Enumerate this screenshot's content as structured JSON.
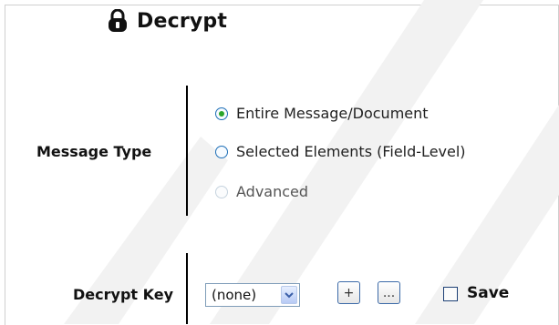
{
  "header": {
    "title": "Decrypt",
    "icon": "lock-icon"
  },
  "message_type": {
    "label": "Message Type",
    "options": [
      {
        "label": "Entire Message/Document",
        "selected": true,
        "enabled": true
      },
      {
        "label": "Selected Elements (Field-Level)",
        "selected": false,
        "enabled": true
      },
      {
        "label": "Advanced",
        "selected": false,
        "enabled": false
      }
    ]
  },
  "decrypt_key": {
    "label": "Decrypt Key",
    "select_value": "(none)",
    "add_button_label": "+",
    "browse_button_label": "...",
    "save_label": "Save",
    "save_checked": false
  },
  "colors": {
    "radio_border": "#1e6fb7",
    "radio_selected_dot": "#2aa52a",
    "button_border": "#3c6aa8",
    "select_border": "#7f9db9"
  }
}
